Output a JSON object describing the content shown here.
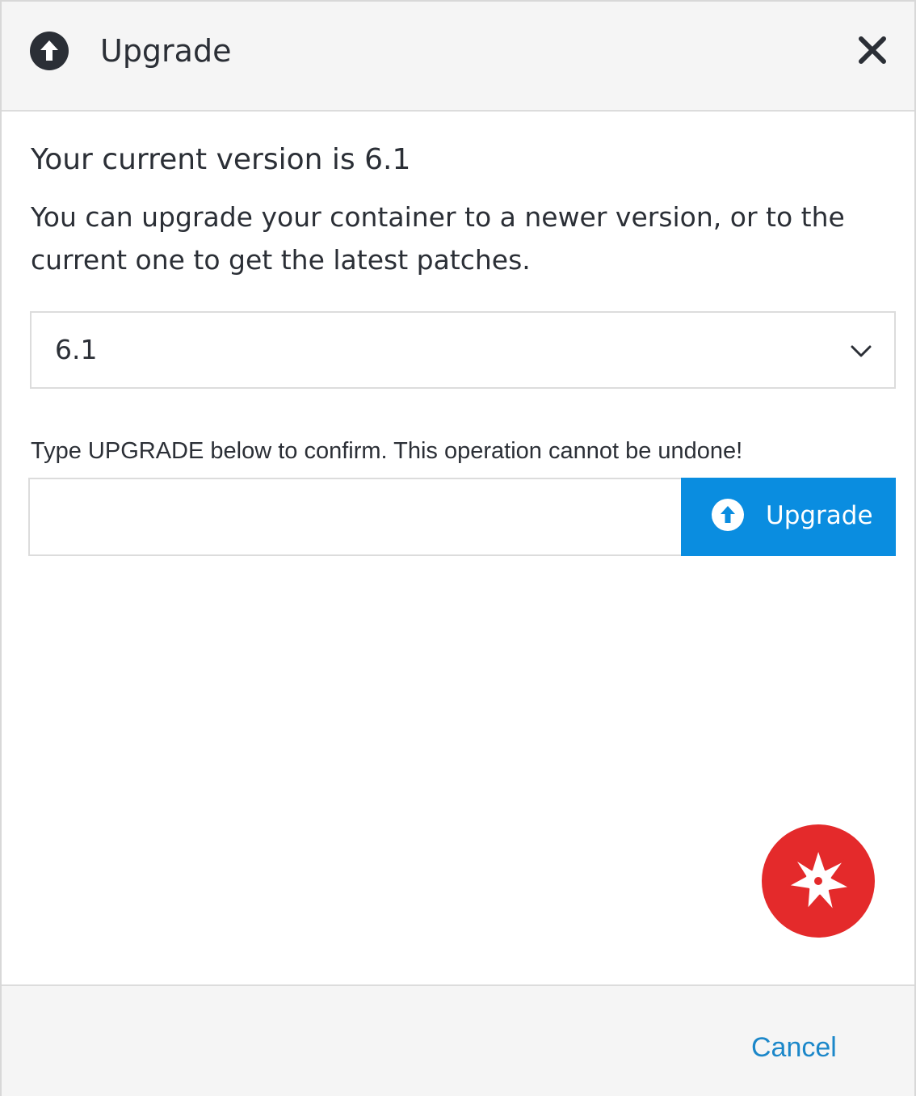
{
  "header": {
    "title": "Upgrade",
    "icon": "arrow-up-circle-icon",
    "close_icon": "close-icon"
  },
  "body": {
    "version_heading": "Your current version is 6.1",
    "description": "You can upgrade your container to a newer version, or to the current one to get the latest patches.",
    "version_select": {
      "selected": "6.1",
      "icon": "chevron-down-icon"
    },
    "confirm_label": "Type UPGRADE below to confirm. This operation cannot be undone!",
    "confirm_input": {
      "value": "",
      "placeholder": ""
    },
    "upgrade_button": {
      "label": "Upgrade",
      "icon": "arrow-up-circle-icon"
    },
    "assist_button_icon": "starburst-icon"
  },
  "footer": {
    "cancel_label": "Cancel"
  },
  "colors": {
    "primary": "#0a8de0",
    "link": "#1b87c9",
    "assist": "#e42a2b",
    "text": "#2b2f36",
    "panel": "#f5f5f5"
  }
}
